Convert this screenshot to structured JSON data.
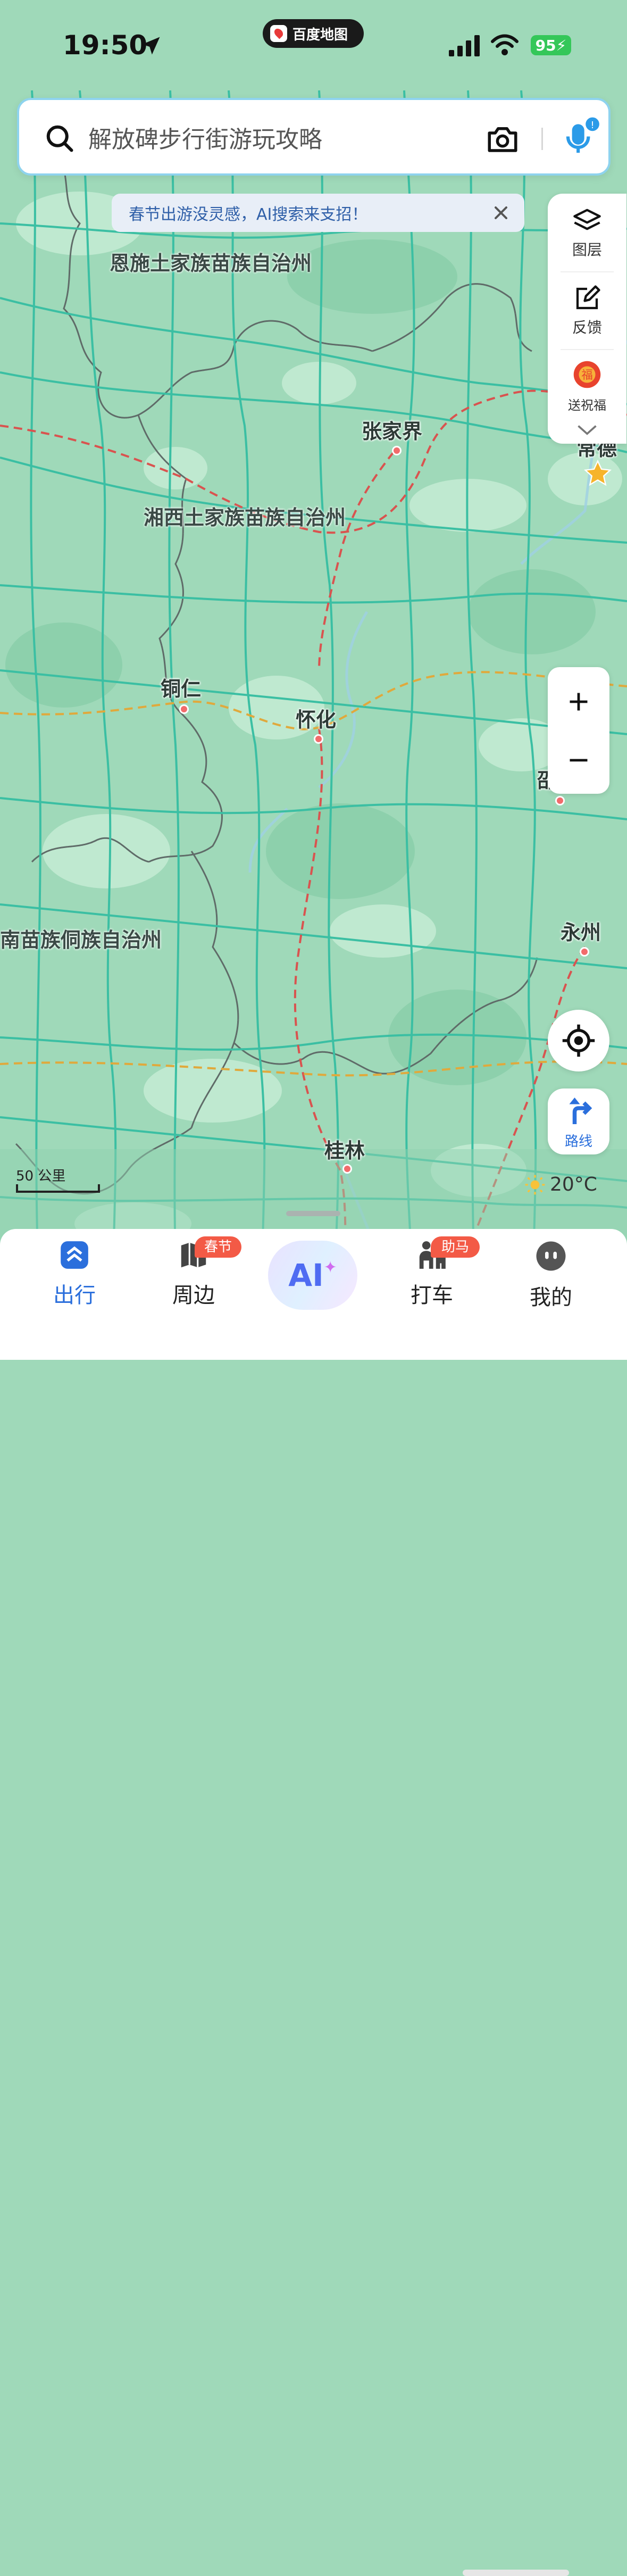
{
  "status_bar": {
    "time": "19:50",
    "app_pill": "百度地图",
    "battery": "95"
  },
  "search": {
    "placeholder": "解放碑步行街游玩攻略"
  },
  "banner": {
    "text": "春节出游没灵感，AI搜索来支招！"
  },
  "tools": {
    "layers": "图层",
    "feedback": "反馈",
    "blessing": "送祝福"
  },
  "map": {
    "prefectures": [
      "恩施土家族苗族自治州",
      "湘西土家族苗族自治州",
      "南苗族侗族自治州"
    ],
    "cities": [
      "张家界",
      "常德",
      "铜仁",
      "怀化",
      "邵",
      "永州",
      "桂林"
    ],
    "scale_label": "50 公里"
  },
  "route": {
    "label": "路线"
  },
  "weather": {
    "temp": "20°C"
  },
  "tabbar": {
    "items": [
      {
        "label": "出行",
        "badge": ""
      },
      {
        "label": "周边",
        "badge": "春节住"
      },
      {
        "label": "AI",
        "badge": ""
      },
      {
        "label": "打车",
        "badge": "助马力"
      },
      {
        "label": "我的",
        "badge": ""
      }
    ]
  },
  "colors": {
    "accent": "#2b6fdc",
    "map_green": "#9fd9b9",
    "road_teal": "#3bbfa3",
    "badge_red": "#f35a46"
  }
}
